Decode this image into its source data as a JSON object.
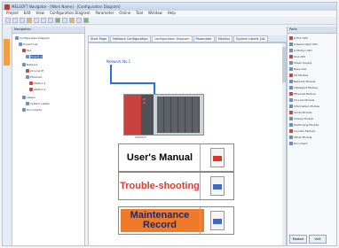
{
  "app": {
    "title": "MELSOFT Navigator - [Work Name] - [Configuration Diagram]"
  },
  "menu": [
    "Project",
    "Edit",
    "View",
    "Configuration Diagram",
    "Parameter",
    "Online",
    "Tool",
    "Window",
    "Help"
  ],
  "tabs": [
    "Start Page",
    "Network Configuration",
    "Configuration Diagram",
    "Parameter",
    "Monitor",
    "System Labels List"
  ],
  "nav": {
    "header": "Navigation",
    "items": [
      {
        "label": "Configuration Diagram",
        "red": false
      },
      {
        "label": "Project List",
        "red": false
      },
      {
        "label": "PLC",
        "red": true
      },
      {
        "label": "Project_A",
        "red": false,
        "selected": true
      },
      {
        "label": "Network",
        "red": false
      },
      {
        "label": "CC-Link IE",
        "red": true
      },
      {
        "label": "Ethernet",
        "red": false
      },
      {
        "label": "Station 1",
        "red": true
      },
      {
        "label": "Station 2",
        "red": true
      },
      {
        "label": "Labels",
        "red": false
      },
      {
        "label": "System Labels",
        "red": false
      },
      {
        "label": "Documents",
        "red": false
      }
    ]
  },
  "canvas": {
    "network_label": "Network No.1",
    "plc_caption": "Q06UDV"
  },
  "documents": [
    {
      "text": "User's Manual",
      "color": "#000000",
      "icon": "pdf-icon",
      "bg": "#ffffff"
    },
    {
      "text": "Trouble-shooting",
      "color": "#e8372b",
      "icon": "word-document-icon",
      "bg": "#ffffff"
    },
    {
      "text": "Maintenance Record",
      "color": "#1a2a6b",
      "icon": "word-document-icon",
      "bg": "#ee7a2a"
    }
  ],
  "props": {
    "header": "Parts",
    "items": [
      "Q PLC CPU",
      "Q Redundant CPU",
      "Q Motion CPU",
      "QnA CPU",
      "Power Supply",
      "Base Unit",
      "I/O Module",
      "Network Module",
      "Intelligent Module",
      "Ethernet Module",
      "CC-Link Module",
      "Information Module",
      "Serial Module",
      "Analog Module",
      "Positioning Module",
      "Counter Module",
      "Other Module",
      "Document"
    ],
    "button_1": "Module",
    "button_2": "Unit"
  }
}
